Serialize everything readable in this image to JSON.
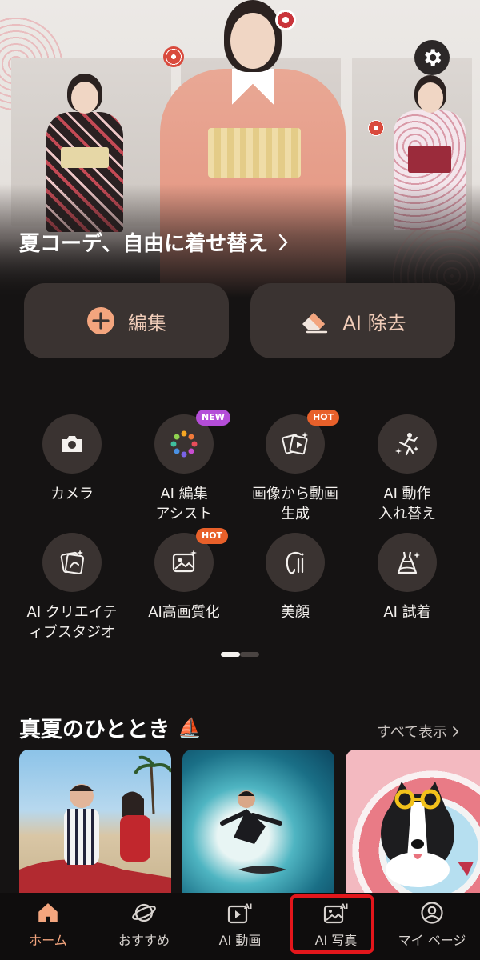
{
  "hero": {
    "title": "夏コーデ、自由に着せ替え",
    "chevron": "›"
  },
  "header": {
    "settings_icon": "gear-icon"
  },
  "actions": {
    "edit_label": "編集",
    "erase_label": "AI 除去"
  },
  "tools": [
    {
      "label": "カメラ",
      "icon": "camera-icon",
      "badge": ""
    },
    {
      "label": "AI 編集\nアシスト",
      "icon": "color-palette-icon",
      "badge": "NEW"
    },
    {
      "label": "画像から動画\n生成",
      "icon": "image-to-video-icon",
      "badge": "HOT"
    },
    {
      "label": "AI 動作\n入れ替え",
      "icon": "dance-motion-icon",
      "badge": ""
    },
    {
      "label": "AI クリエイテ\nィブスタジオ",
      "icon": "creative-studio-icon",
      "badge": ""
    },
    {
      "label": "AI高画質化",
      "icon": "image-enhance-icon",
      "badge": "HOT"
    },
    {
      "label": "美顔",
      "icon": "face-beauty-icon",
      "badge": ""
    },
    {
      "label": "AI 試着",
      "icon": "dress-tryon-icon",
      "badge": ""
    }
  ],
  "pager": {
    "pages": 2,
    "current": 1
  },
  "section": {
    "title": "真夏のひととき",
    "emoji": "⛵",
    "see_all": "すべて表示"
  },
  "nav": {
    "items": [
      {
        "label": "ホーム",
        "icon": "home-icon",
        "active": true
      },
      {
        "label": "おすすめ",
        "icon": "planet-icon",
        "active": false
      },
      {
        "label": "AI 動画",
        "icon": "ai-video-icon",
        "active": false
      },
      {
        "label": "AI 写真",
        "icon": "ai-photo-icon",
        "active": false
      },
      {
        "label": "マイ ページ",
        "icon": "profile-icon",
        "active": false
      }
    ]
  },
  "colors": {
    "background": "#151313",
    "button_bg": "#3a3331",
    "accent": "#f3a57e",
    "badge_new": "#b44dd8",
    "badge_hot": "#e8602a",
    "highlight": "#e3161b"
  }
}
